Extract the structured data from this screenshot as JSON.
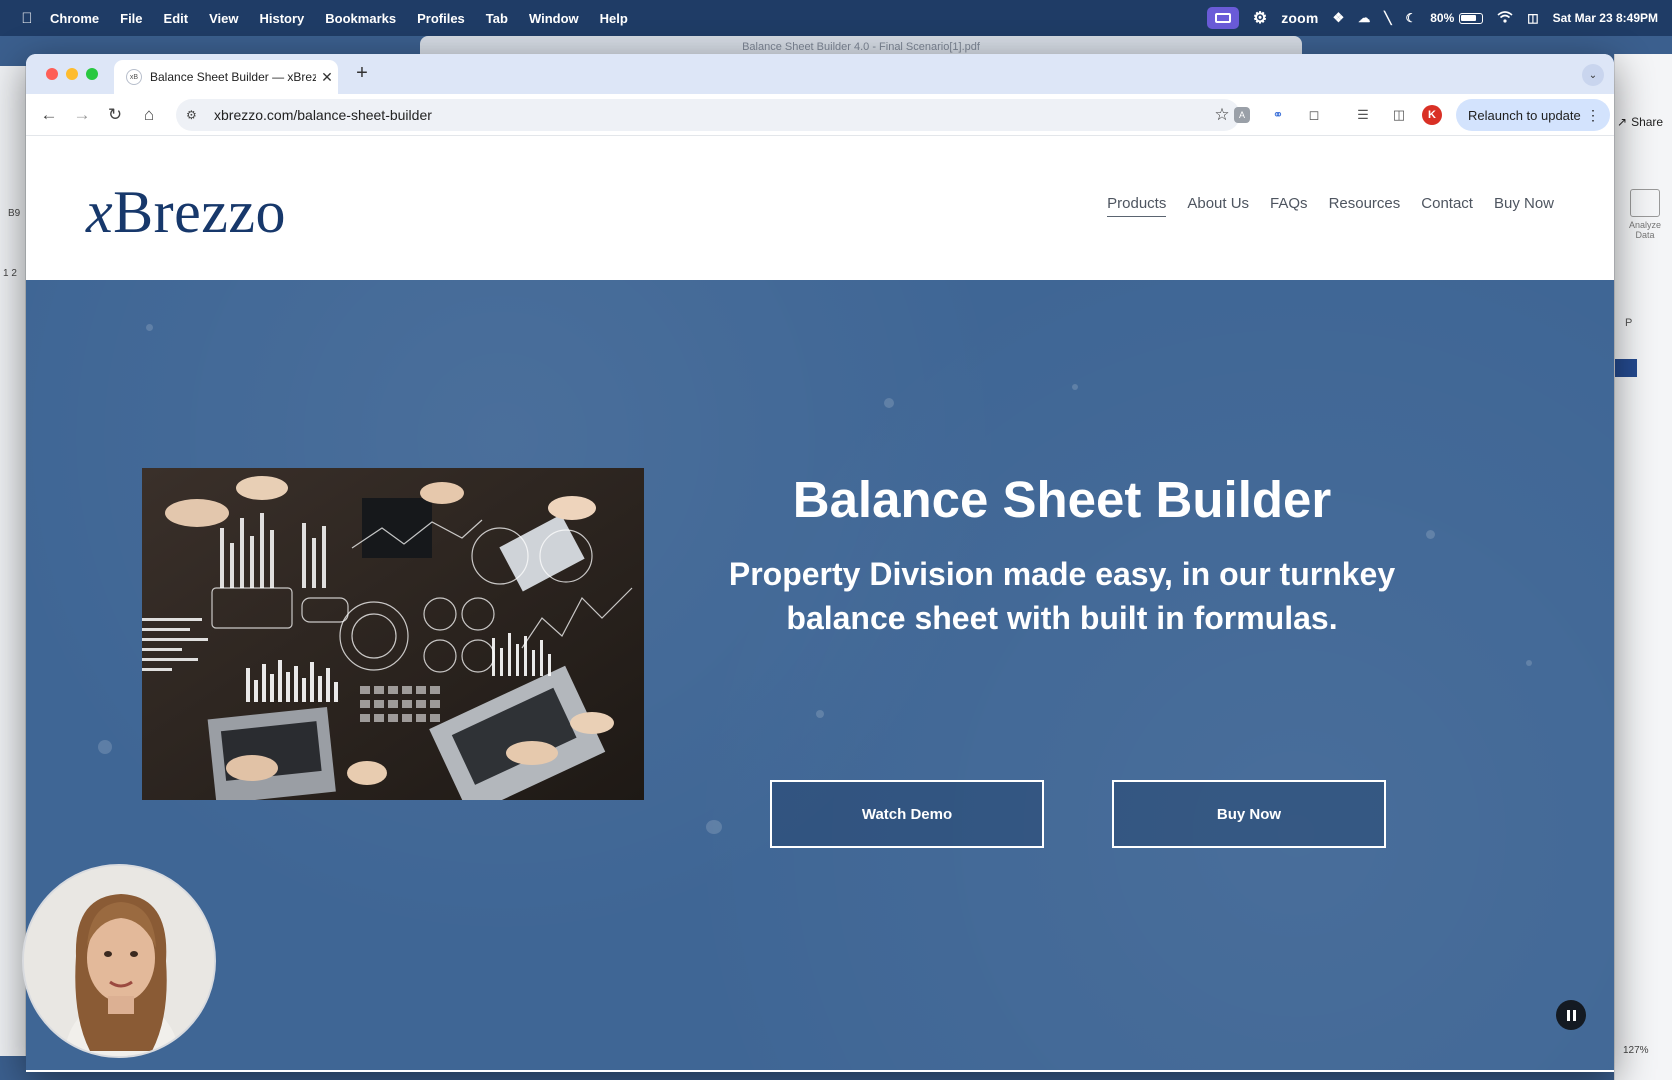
{
  "menubar": {
    "app_name": "Chrome",
    "items": [
      "File",
      "Edit",
      "View",
      "History",
      "Bookmarks",
      "Profiles",
      "Tab",
      "Window",
      "Help"
    ],
    "zoom_label": "zoom",
    "battery": "80%",
    "battery_level": 0.8,
    "datetime": "Sat Mar 23  8:49PM"
  },
  "behind_window_title": "Balance Sheet Builder 4.0 - Final Scenario[1].pdf",
  "background_app": {
    "share_label": "Share",
    "analyze_label": "Analyze Data",
    "column_label": "P",
    "cell_ref": "B9",
    "row_header": "1 2",
    "zoom_level": "127%"
  },
  "browser": {
    "tab_title": "Balance Sheet Builder — xBrezzo",
    "favicon_text": "xB",
    "url": "xbrezzo.com/balance-sheet-builder",
    "profile_initial": "K",
    "relaunch_label": "Relaunch to update"
  },
  "site": {
    "logo": "Brezzo",
    "logo_x": "x",
    "nav": [
      "Products",
      "About Us",
      "FAQs",
      "Resources",
      "Contact",
      "Buy Now"
    ],
    "hero": {
      "title": "Balance Sheet Builder",
      "subtitle_line1": "Property Division made easy, in our turnkey",
      "subtitle_line2": "balance sheet with built in formulas.",
      "watch_demo": "Watch Demo",
      "buy_now": "Buy Now"
    }
  },
  "colors": {
    "menubar": "#1f3c66",
    "hero_bg": "#3f6695",
    "logo": "#17386b",
    "relaunch_bg": "#d3e3fd",
    "profile": "#d93025"
  }
}
